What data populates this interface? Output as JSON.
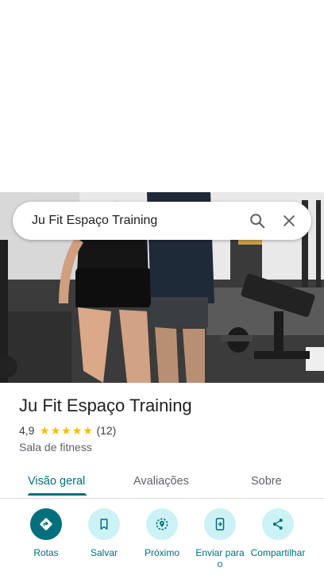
{
  "search": {
    "query": "Ju Fit Espaço Training",
    "search_icon": "search-icon",
    "close_icon": "close-icon"
  },
  "place": {
    "name": "Ju Fit Espaço Training",
    "rating": "4,9",
    "stars": 5,
    "reviews": "(12)",
    "category": "Sala de fitness"
  },
  "tabs": [
    {
      "label": "Visão geral",
      "active": true
    },
    {
      "label": "Avaliações",
      "active": false
    },
    {
      "label": "Sobre",
      "active": false
    }
  ],
  "actions": [
    {
      "label": "Rotas",
      "icon": "directions-icon"
    },
    {
      "label": "Salvar",
      "icon": "bookmark-icon"
    },
    {
      "label": "Próximo",
      "icon": "nearby-icon"
    },
    {
      "label": "Enviar para o",
      "icon": "send-to-phone-icon"
    },
    {
      "label": "Compartilhar",
      "icon": "share-icon"
    }
  ],
  "colors": {
    "accent": "#00707c",
    "accent_light": "#ccf2f5",
    "star": "#fbbc04"
  }
}
